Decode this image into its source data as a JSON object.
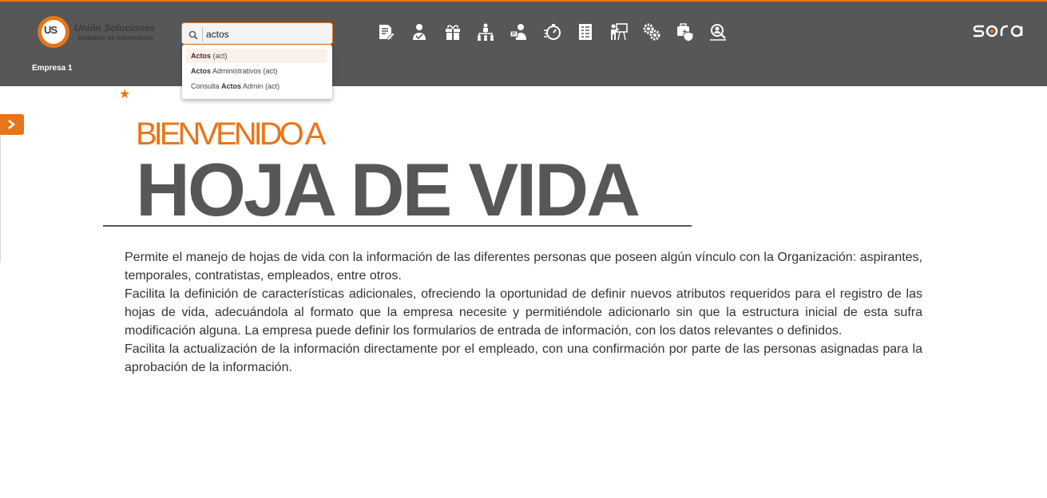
{
  "header": {
    "logo": {
      "name": "Unión Soluciones",
      "subtitle": "Sistemas de Información",
      "monogram": "US"
    },
    "company": "Empresa 1",
    "search": {
      "value": "actos",
      "results": [
        {
          "bold": "Actos",
          "rest": " (act)"
        },
        {
          "bold": "Actos",
          "rest": " Administrativos (act)"
        },
        {
          "prefix": "Consulta ",
          "bold": "Actos",
          "rest": " Admin (act)"
        }
      ]
    },
    "nav_icons": [
      "edit-document-icon",
      "person-approve-icon",
      "gift-icon",
      "org-chart-icon",
      "user-card-icon",
      "stopwatch-icon",
      "list-document-icon",
      "presentation-icon",
      "gears-icon",
      "shield-heart-icon",
      "person-search-icon"
    ],
    "brand": "sara"
  },
  "main": {
    "welcome": "BIENVENIDO A",
    "module_title": "HOJA DE VIDA",
    "paragraphs": [
      "Permite el manejo de hojas de vida con la información de las diferentes personas que poseen algún vínculo con la Organización: aspirantes, temporales, contratistas, empleados, entre otros.",
      "Facilita la definición de características adicionales, ofreciendo la oportunidad de definir nuevos atributos requeridos para el registro de las hojas de vida, adecuándola al formato que la empresa necesite y permitiéndole adicionarlo sin que la estructura inicial de esta sufra modificación alguna. La empresa puede definir los formularios de entrada de información, con los datos relevantes o definidos.",
      "Facilita la actualización de la información directamente por el empleado, con una confirmación por parte de las personas asignadas para la aprobación de la información."
    ]
  },
  "colors": {
    "accent": "#e8751a",
    "header_bg": "#575757",
    "title": "#575757"
  }
}
